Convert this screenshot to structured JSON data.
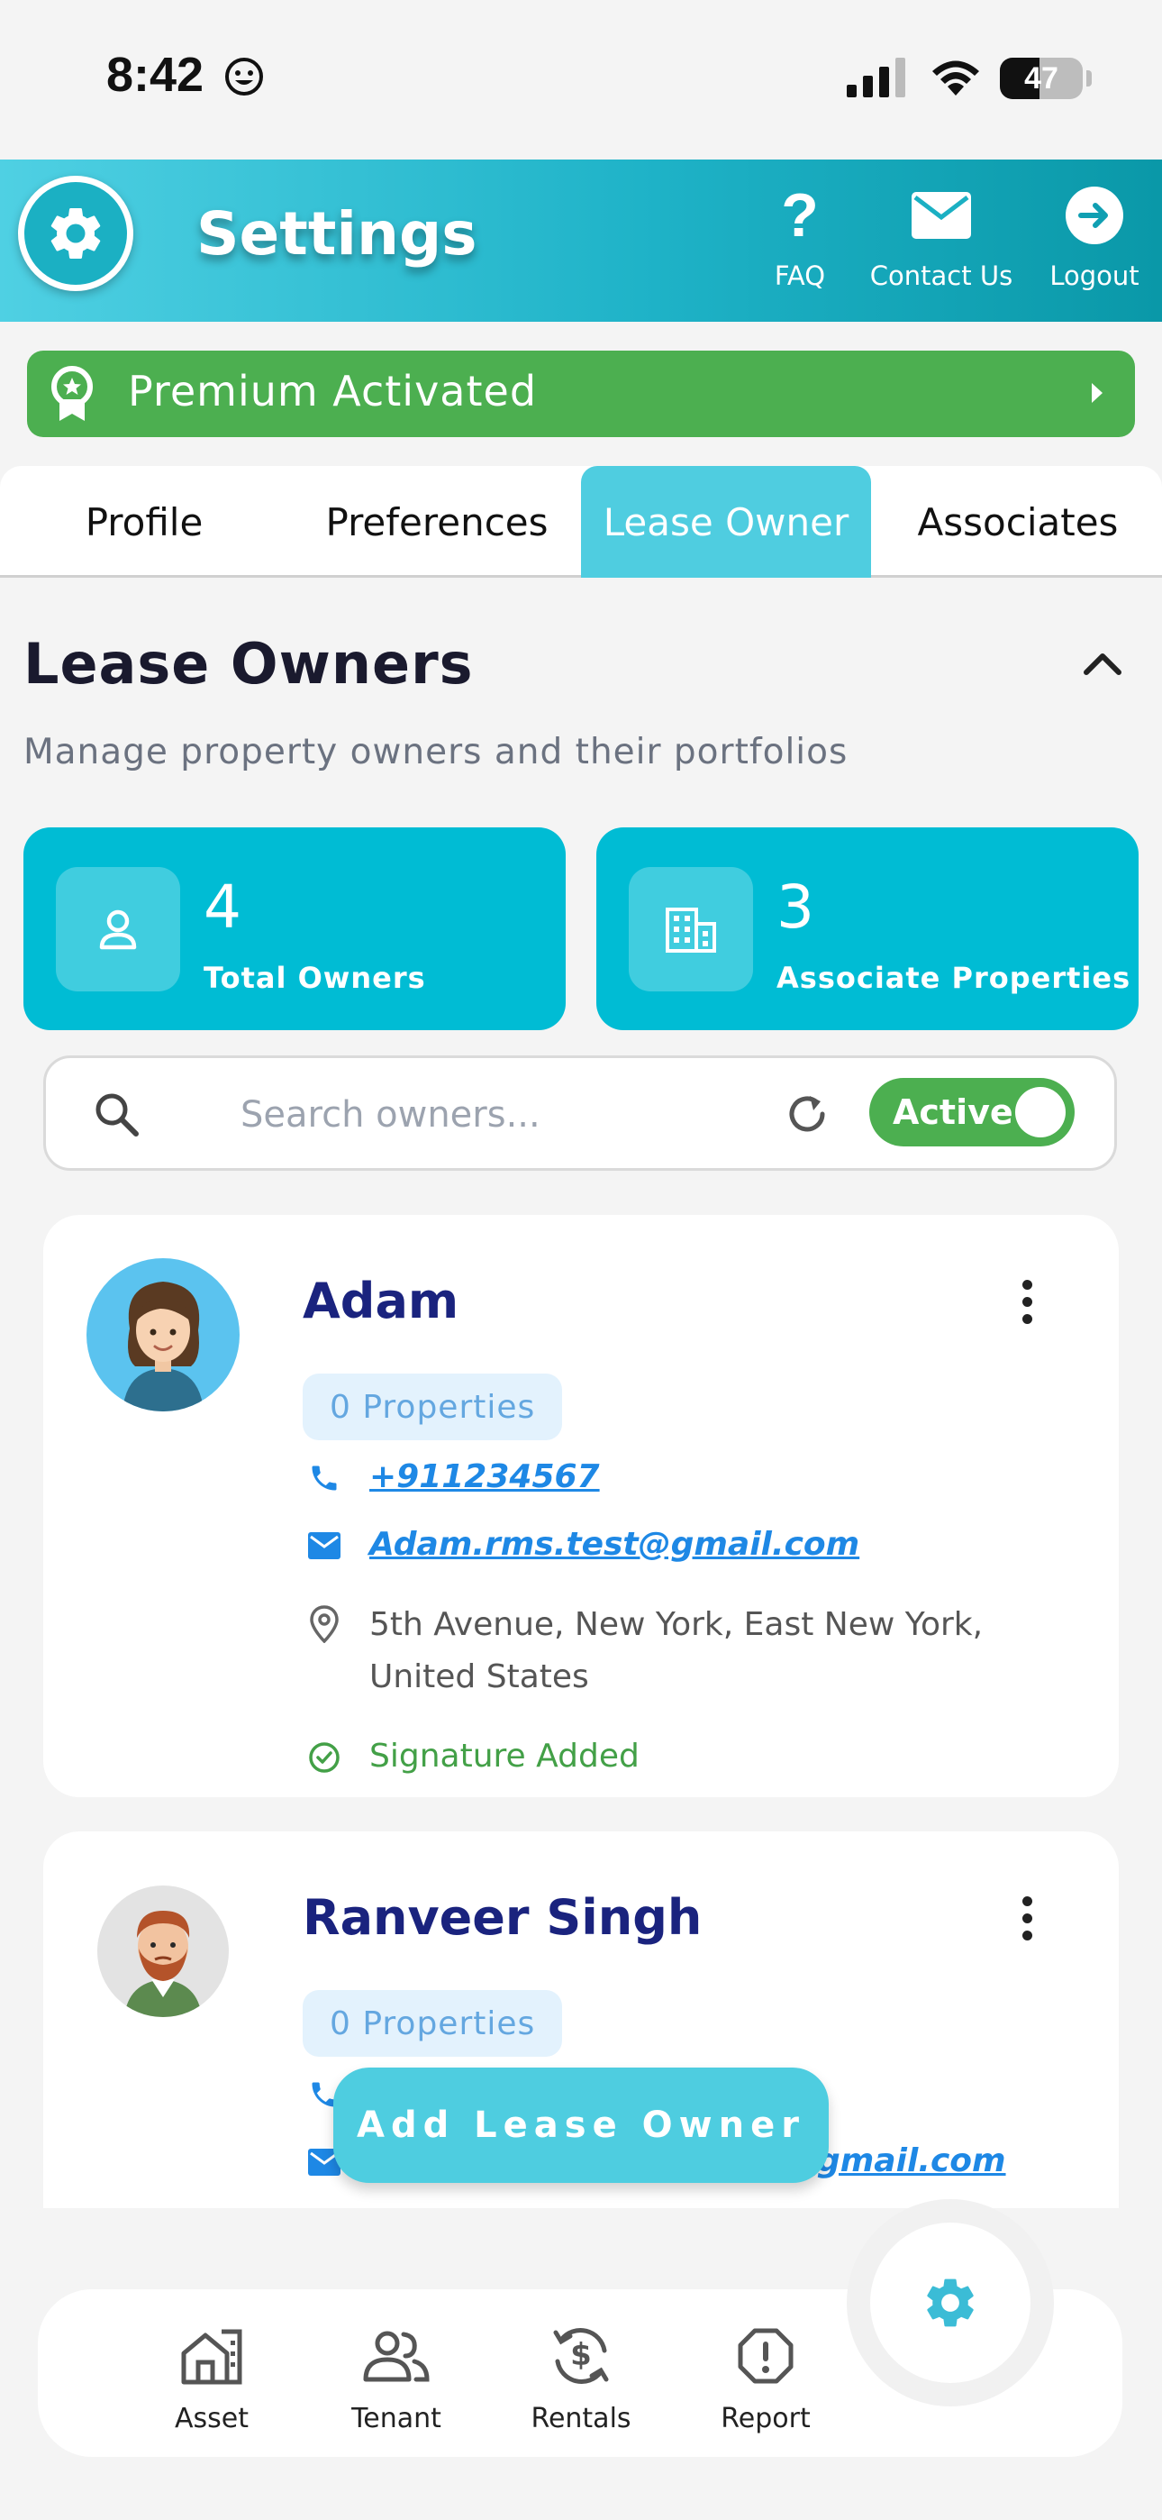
{
  "status_bar": {
    "time": "8:42",
    "battery": "47"
  },
  "header": {
    "title": "Settings",
    "faq_label": "FAQ",
    "contact_label": "Contact Us",
    "logout_label": "Logout"
  },
  "premium": {
    "label": "Premium Activated"
  },
  "tabs": [
    {
      "label": "Profile"
    },
    {
      "label": "Preferences"
    },
    {
      "label": "Lease Owner"
    },
    {
      "label": "Associates"
    }
  ],
  "section": {
    "title": "Lease Owners",
    "subtitle": "Manage property owners and their portfolios"
  },
  "stats": {
    "total_owners": {
      "value": "4",
      "label": "Total Owners"
    },
    "associate_properties": {
      "value": "3",
      "label": "Associate Properties"
    }
  },
  "search": {
    "placeholder": "Search owners...",
    "value": "",
    "toggle_label": "Active"
  },
  "owners": [
    {
      "name": "Adam",
      "properties": "0 Properties",
      "phone": "+911234567",
      "email": "Adam.rms.test@gmail.com",
      "address": "5th Avenue, New York, East New York, United States",
      "signature": "Signature Added"
    },
    {
      "name": "Ranveer Singh",
      "properties": "0 Properties",
      "phone": "",
      "email": "...@gmail.com"
    }
  ],
  "add_button": {
    "label": "Add Lease Owner"
  },
  "bottom_nav": [
    {
      "label": "Asset"
    },
    {
      "label": "Tenant"
    },
    {
      "label": "Rentals"
    },
    {
      "label": "Report"
    }
  ],
  "colors": {
    "header_start": "#4fd0e3",
    "header_end": "#0a98a8",
    "premium_green": "#4caf50",
    "accent_cyan": "#00bcd4",
    "active_tab": "#4fcde0",
    "name_navy": "#1a237e",
    "link_blue": "#1e88e5"
  },
  "icons": {
    "header": "gear-icon",
    "faq": "question-icon",
    "contact": "mail-icon",
    "logout": "arrow-right-circle-icon",
    "premium": "ribbon-icon",
    "collapse": "chevron-up-icon",
    "total_owners": "person-icon",
    "associate_properties": "building-icon",
    "search": "search-icon",
    "refresh": "refresh-icon",
    "more": "more-vertical-icon",
    "phone": "phone-icon",
    "email": "mail-icon",
    "address": "location-pin-icon",
    "signature": "check-circle-icon",
    "nav": [
      "house-icon",
      "users-icon",
      "dollar-cycle-icon",
      "alert-icon",
      "gear-icon"
    ]
  }
}
